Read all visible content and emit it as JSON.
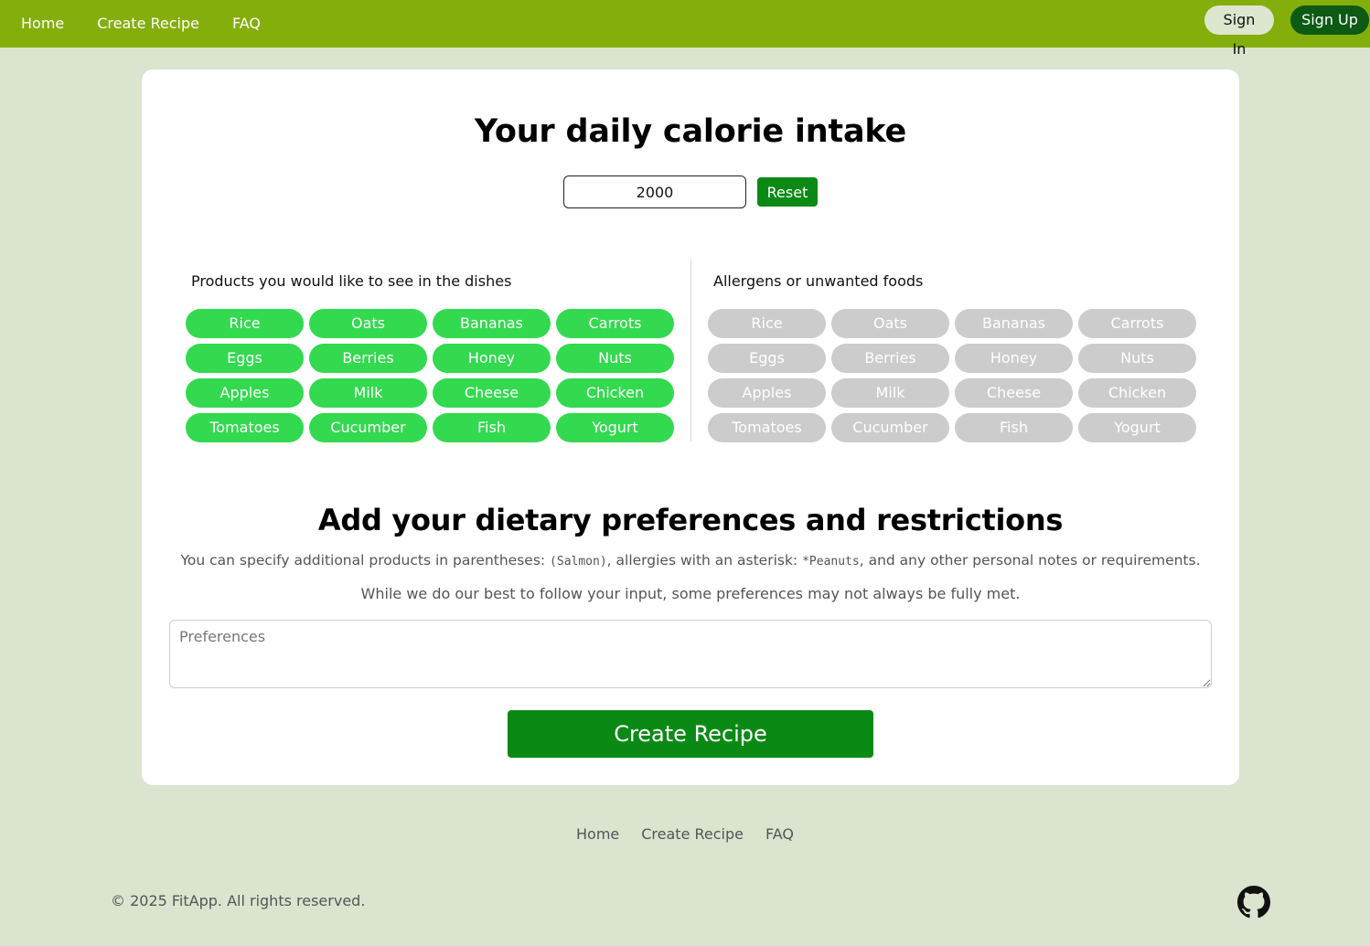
{
  "nav": {
    "links": [
      "Home",
      "Create Recipe",
      "FAQ"
    ],
    "sign_in": "Sign In",
    "sign_up": "Sign Up"
  },
  "calorie": {
    "title": "Your daily calorie intake",
    "value": "2000",
    "reset_label": "Reset"
  },
  "products": {
    "title": "Products you would like to see in the dishes",
    "items": [
      "Rice",
      "Oats",
      "Bananas",
      "Carrots",
      "Eggs",
      "Berries",
      "Honey",
      "Nuts",
      "Apples",
      "Milk",
      "Cheese",
      "Chicken",
      "Tomatoes",
      "Cucumber",
      "Fish",
      "Yogurt"
    ]
  },
  "allergens": {
    "title": "Allergens or unwanted foods",
    "items": [
      "Rice",
      "Oats",
      "Bananas",
      "Carrots",
      "Eggs",
      "Berries",
      "Honey",
      "Nuts",
      "Apples",
      "Milk",
      "Cheese",
      "Chicken",
      "Tomatoes",
      "Cucumber",
      "Fish",
      "Yogurt"
    ]
  },
  "preferences": {
    "title": "Add your dietary preferences and restrictions",
    "note1_a": "You can specify additional products in parentheses: ",
    "note1_code1": "(Salmon)",
    "note1_b": ", allergies with an asterisk: ",
    "note1_code2": "*Peanuts",
    "note1_c": ", and any other personal notes or requirements.",
    "note2": "While we do our best to follow your input, some preferences may not always be fully met.",
    "placeholder": "Preferences",
    "create_label": "Create Recipe"
  },
  "footer": {
    "links": [
      "Home",
      "Create Recipe",
      "FAQ"
    ],
    "copyright": "© 2025  FitApp.  All rights reserved.",
    "icon": "github-icon"
  },
  "colors": {
    "navbar": "#84ae0c",
    "accent": "#0a8a15",
    "pill_selected": "#33d94f",
    "pill_unselected": "#cccccc",
    "background": "#dbe4cf"
  }
}
